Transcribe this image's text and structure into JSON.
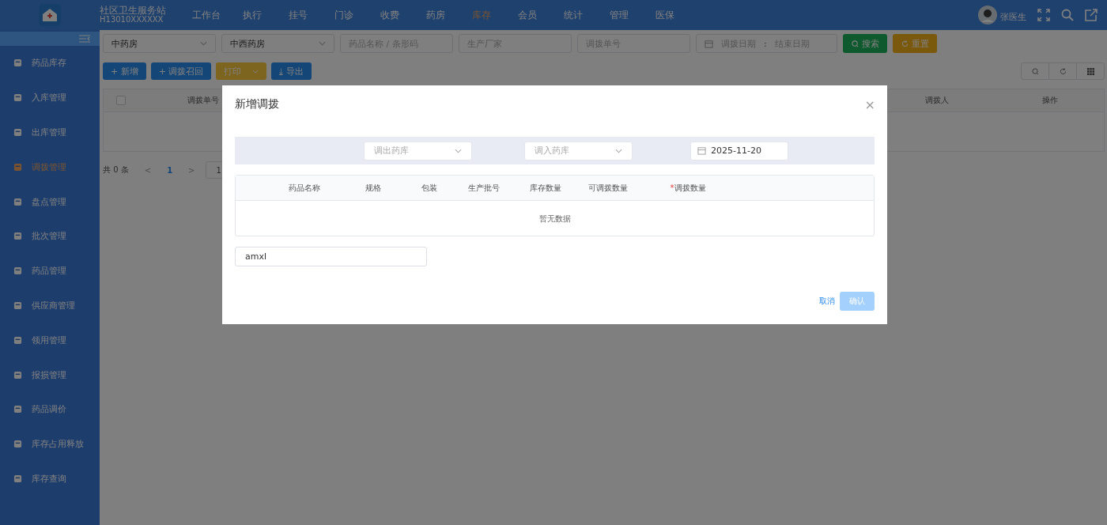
{
  "header": {
    "org_name": "社区卫生服务站",
    "org_code": "H13010XXXXXX",
    "user": "张医生"
  },
  "nav": [
    {
      "label": "工作台",
      "selected": false
    },
    {
      "label": "执行",
      "selected": false
    },
    {
      "label": "挂号",
      "selected": false
    },
    {
      "label": "门诊",
      "selected": false
    },
    {
      "label": "收费",
      "selected": false
    },
    {
      "label": "药房",
      "selected": false
    },
    {
      "label": "库存",
      "selected": true
    },
    {
      "label": "会员",
      "selected": false
    },
    {
      "label": "统计",
      "selected": false
    },
    {
      "label": "管理",
      "selected": false
    },
    {
      "label": "医保",
      "selected": false
    }
  ],
  "sidebar": {
    "items": [
      {
        "label": "药品库存",
        "selected": false
      },
      {
        "label": "入库管理",
        "selected": false
      },
      {
        "label": "出库管理",
        "selected": false
      },
      {
        "label": "调拨管理",
        "selected": true
      },
      {
        "label": "盘点管理",
        "selected": false
      },
      {
        "label": "批次管理",
        "selected": false
      },
      {
        "label": "药品管理",
        "selected": false
      },
      {
        "label": "供应商管理",
        "selected": false
      },
      {
        "label": "领用管理",
        "selected": false
      },
      {
        "label": "报损管理",
        "selected": false
      },
      {
        "label": "药品调价",
        "selected": false
      },
      {
        "label": "库存占用释放",
        "selected": false
      },
      {
        "label": "库存查询",
        "selected": false
      }
    ]
  },
  "filters": {
    "selects": [
      "中药房",
      "中西药房"
    ],
    "inputs": [
      {
        "placeholder": "药品名称 / 条形码"
      },
      {
        "placeholder": "生产厂家"
      },
      {
        "placeholder": "调拨单号"
      }
    ],
    "date_range": {
      "start_placeholder": "调拨日期",
      "separator": ":",
      "end_placeholder": "结束日期"
    },
    "search_button": "搜索",
    "reset_button": "重置"
  },
  "toolbar": [
    {
      "label": "新增",
      "icon": "+",
      "kind": "primary"
    },
    {
      "label": "调拨召回",
      "icon": "+",
      "kind": "primary"
    },
    {
      "label": "打印",
      "kind": "split"
    },
    {
      "label": "导出",
      "icon": "⤓",
      "kind": "primary"
    }
  ],
  "table": {
    "header_checkbox": {
      "checked": false
    },
    "columns": [
      "调拨单号",
      "调拨人",
      "操作"
    ]
  },
  "pagination": {
    "total": "共 0 条",
    "prev": "<",
    "page": "1",
    "next": ">",
    "page_size": "1"
  },
  "dialog": {
    "title": "新增调拨",
    "close": "×",
    "from_placeholder": "调出药库",
    "to_placeholder": "调入药库",
    "date": "2025-11-20",
    "columns": [
      {
        "label": "药品名称"
      },
      {
        "label": "规格"
      },
      {
        "label": "包装"
      },
      {
        "label": "生产批号"
      },
      {
        "label": "库存数量"
      },
      {
        "label": "可调拨数量"
      },
      {
        "label": "调拨数量",
        "required_mark": "*"
      }
    ],
    "empty_text": "暂无数据",
    "search_value": "amxl",
    "cancel": "取消",
    "confirm": {
      "label": "确认",
      "disabled": true
    }
  }
}
